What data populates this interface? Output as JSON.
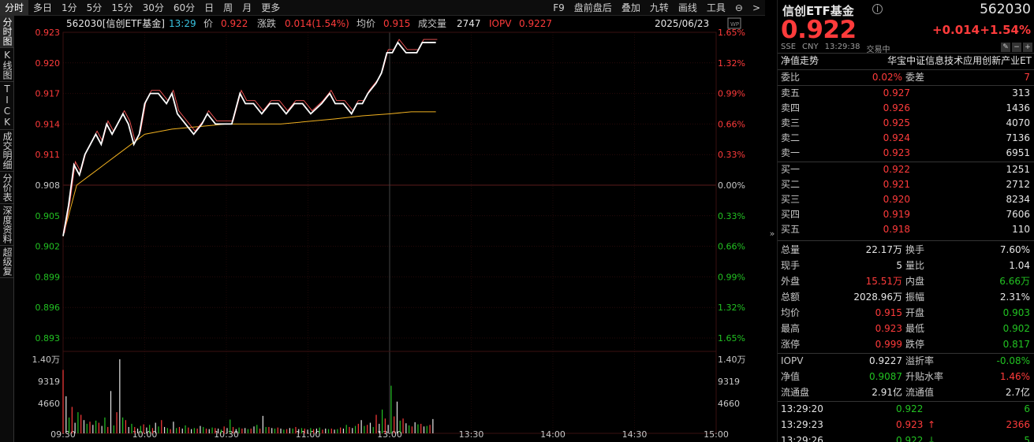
{
  "tabs": {
    "left": [
      "分时",
      "多日",
      "1分",
      "5分",
      "15分",
      "30分",
      "60分",
      "日",
      "周",
      "月",
      "更多"
    ],
    "active": 0,
    "right": [
      "F9",
      "盘前盘后",
      "叠加",
      "九转",
      "画线",
      "工具"
    ],
    "menu": "⊖",
    "arrow": ">"
  },
  "sidebar": [
    "分时图",
    "K线图",
    "TICK",
    "成交明细",
    "分价表",
    "深度资料",
    "超级复"
  ],
  "chart": {
    "info": {
      "code_name": "562030[信创ETF基金]",
      "time": "13:29",
      "price_label": "价",
      "price": "0.922",
      "chg_label": "涨跌",
      "chg": "0.014(1.54%)",
      "avg_label": "均价",
      "avg": "0.915",
      "vol_label": "成交量",
      "vol": "2747",
      "iopv_label": "IOPV",
      "iopv": "0.9227",
      "date": "2025/06/23"
    },
    "wp": "WP",
    "y_left": [
      "0.923",
      "0.920",
      "0.917",
      "0.914",
      "0.911",
      "0.908",
      "0.905",
      "0.902",
      "0.899",
      "0.896",
      "0.893"
    ],
    "y_right": [
      "1.65%",
      "1.32%",
      "0.99%",
      "0.66%",
      "0.33%",
      "0.00%",
      "0.33%",
      "0.66%",
      "0.99%",
      "1.32%",
      "1.65%"
    ],
    "vol_left": [
      "1.40万",
      "9319",
      "4660"
    ],
    "vol_right": [
      "1.40万",
      "9319",
      "4660"
    ],
    "x_labels": [
      "09:30",
      "10:00",
      "10:30",
      "11:00",
      "13:00",
      "13:30",
      "14:00",
      "14:30",
      "15:00"
    ]
  },
  "chart_data": {
    "type": "line",
    "y_range": [
      0.893,
      0.923
    ],
    "prev_close": 0.908,
    "price": [
      [
        0,
        0.903
      ],
      [
        2,
        0.906
      ],
      [
        4,
        0.91
      ],
      [
        6,
        0.909
      ],
      [
        8,
        0.911
      ],
      [
        10,
        0.912
      ],
      [
        12,
        0.913
      ],
      [
        14,
        0.912
      ],
      [
        16,
        0.914
      ],
      [
        18,
        0.913
      ],
      [
        20,
        0.914
      ],
      [
        22,
        0.915
      ],
      [
        24,
        0.914
      ],
      [
        26,
        0.912
      ],
      [
        28,
        0.913
      ],
      [
        30,
        0.916
      ],
      [
        32,
        0.917
      ],
      [
        35,
        0.917
      ],
      [
        38,
        0.916
      ],
      [
        40,
        0.917
      ],
      [
        42,
        0.915
      ],
      [
        45,
        0.914
      ],
      [
        48,
        0.913
      ],
      [
        51,
        0.914
      ],
      [
        53,
        0.915
      ],
      [
        56,
        0.914
      ],
      [
        60,
        0.914
      ],
      [
        62,
        0.914
      ],
      [
        65,
        0.917
      ],
      [
        67,
        0.916
      ],
      [
        70,
        0.916
      ],
      [
        73,
        0.915
      ],
      [
        76,
        0.916
      ],
      [
        79,
        0.916
      ],
      [
        82,
        0.915
      ],
      [
        85,
        0.916
      ],
      [
        88,
        0.916
      ],
      [
        91,
        0.915
      ],
      [
        95,
        0.916
      ],
      [
        98,
        0.917
      ],
      [
        100,
        0.916
      ],
      [
        103,
        0.916
      ],
      [
        106,
        0.915
      ],
      [
        108,
        0.916
      ],
      [
        110,
        0.916
      ],
      [
        112,
        0.917
      ],
      [
        115,
        0.918
      ],
      [
        117,
        0.919
      ],
      [
        119,
        0.921
      ],
      [
        121,
        0.921
      ],
      [
        123,
        0.922
      ],
      [
        126,
        0.921
      ],
      [
        130,
        0.921
      ],
      [
        132,
        0.922
      ],
      [
        134,
        0.922
      ],
      [
        136,
        0.922
      ],
      [
        137,
        0.922
      ]
    ],
    "avg": [
      [
        0,
        0.903
      ],
      [
        5,
        0.908
      ],
      [
        10,
        0.909
      ],
      [
        15,
        0.91
      ],
      [
        20,
        0.911
      ],
      [
        30,
        0.913
      ],
      [
        40,
        0.9135
      ],
      [
        60,
        0.914
      ],
      [
        80,
        0.914
      ],
      [
        100,
        0.9145
      ],
      [
        110,
        0.9148
      ],
      [
        120,
        0.915
      ],
      [
        128,
        0.9152
      ],
      [
        137,
        0.9152
      ]
    ],
    "volume_max": 14000,
    "volume": [
      12000,
      7000,
      3000,
      5000,
      2000,
      4000,
      3500,
      2500,
      1800,
      2200,
      1600,
      2400,
      2000,
      1400,
      3000,
      1200,
      8000,
      1500,
      4000,
      14000,
      3000,
      2500,
      1200,
      1800,
      1200,
      900,
      1400,
      1700,
      1100,
      1600,
      1000,
      2000,
      1300,
      2500,
      1200,
      1000,
      800,
      2200,
      1000,
      1200,
      900,
      1500,
      1100,
      800,
      1000,
      900,
      1400,
      1200,
      900,
      800,
      1100,
      1000,
      900,
      700,
      1300,
      1000,
      2600,
      1200,
      800,
      1100,
      900,
      1000,
      800,
      900,
      1300,
      1600,
      900,
      3300,
      1200,
      1200,
      1000,
      900,
      1100,
      900,
      700,
      800,
      1000,
      900,
      1200,
      800,
      1000,
      900,
      700,
      1000,
      800,
      900,
      1100,
      700,
      900,
      800,
      900,
      700,
      800,
      1100,
      900,
      1600,
      1200,
      1000,
      1400,
      1800,
      2500,
      1400,
      1600,
      2000,
      1200,
      3500,
      1800,
      4500,
      2800,
      1600,
      9000,
      3200,
      6000,
      2400,
      2800,
      1900,
      1500,
      1300,
      2100,
      1700,
      1800,
      1300,
      1400,
      1600,
      2700
    ]
  },
  "quote": {
    "name": "信创ETF基金",
    "info_icon": "i",
    "code": "562030",
    "price": "0.922",
    "chg": "+0.014",
    "pct": "+1.54%",
    "sub": [
      "SSE",
      "CNY",
      "13:29:38",
      "交易中"
    ],
    "icons": [
      "✎",
      "−",
      "+"
    ],
    "nav_label": "净值走势",
    "index_name": "华宝中证信息技术应用创新产业ET",
    "wb_label": "委比",
    "wb": "0.02%",
    "wc_label": "委差",
    "wc": "7",
    "sell": [
      [
        "卖五",
        "0.927",
        "313"
      ],
      [
        "卖四",
        "0.926",
        "1436"
      ],
      [
        "卖三",
        "0.925",
        "4070"
      ],
      [
        "卖二",
        "0.924",
        "7136"
      ],
      [
        "卖一",
        "0.923",
        "6951"
      ]
    ],
    "buy": [
      [
        "买一",
        "0.922",
        "1251"
      ],
      [
        "买二",
        "0.921",
        "2712"
      ],
      [
        "买三",
        "0.920",
        "8234"
      ],
      [
        "买四",
        "0.919",
        "7606"
      ],
      [
        "买五",
        "0.918",
        "110"
      ]
    ],
    "stats": [
      [
        "总量",
        "22.17万",
        "white",
        "换手",
        "7.60%",
        "white"
      ],
      [
        "现手",
        "5",
        "white",
        "量比",
        "1.04",
        "white"
      ],
      [
        "外盘",
        "15.51万",
        "red",
        "内盘",
        "6.66万",
        "green"
      ],
      [
        "总额",
        "2028.96万",
        "white",
        "振幅",
        "2.31%",
        "white"
      ],
      [
        "均价",
        "0.915",
        "red",
        "开盘",
        "0.903",
        "green"
      ],
      [
        "最高",
        "0.923",
        "red",
        "最低",
        "0.902",
        "green"
      ],
      [
        "涨停",
        "0.999",
        "red",
        "跌停",
        "0.817",
        "green"
      ]
    ],
    "stats2": [
      [
        "IOPV",
        "0.9227",
        "white",
        "溢折率",
        "-0.08%",
        "green"
      ],
      [
        "净值",
        "0.9087",
        "green",
        "升贴水率",
        "1.46%",
        "red"
      ],
      [
        "流通盘",
        "2.91亿",
        "white",
        "流通值",
        "2.7亿",
        "white"
      ]
    ],
    "ticks": [
      [
        "13:29:20",
        "0.922",
        "",
        "6",
        "green"
      ],
      [
        "13:29:23",
        "0.923",
        "↑",
        "2366",
        "red"
      ],
      [
        "13:29:26",
        "0.922",
        "↓",
        "5",
        "green"
      ]
    ],
    "collapse": "»"
  }
}
